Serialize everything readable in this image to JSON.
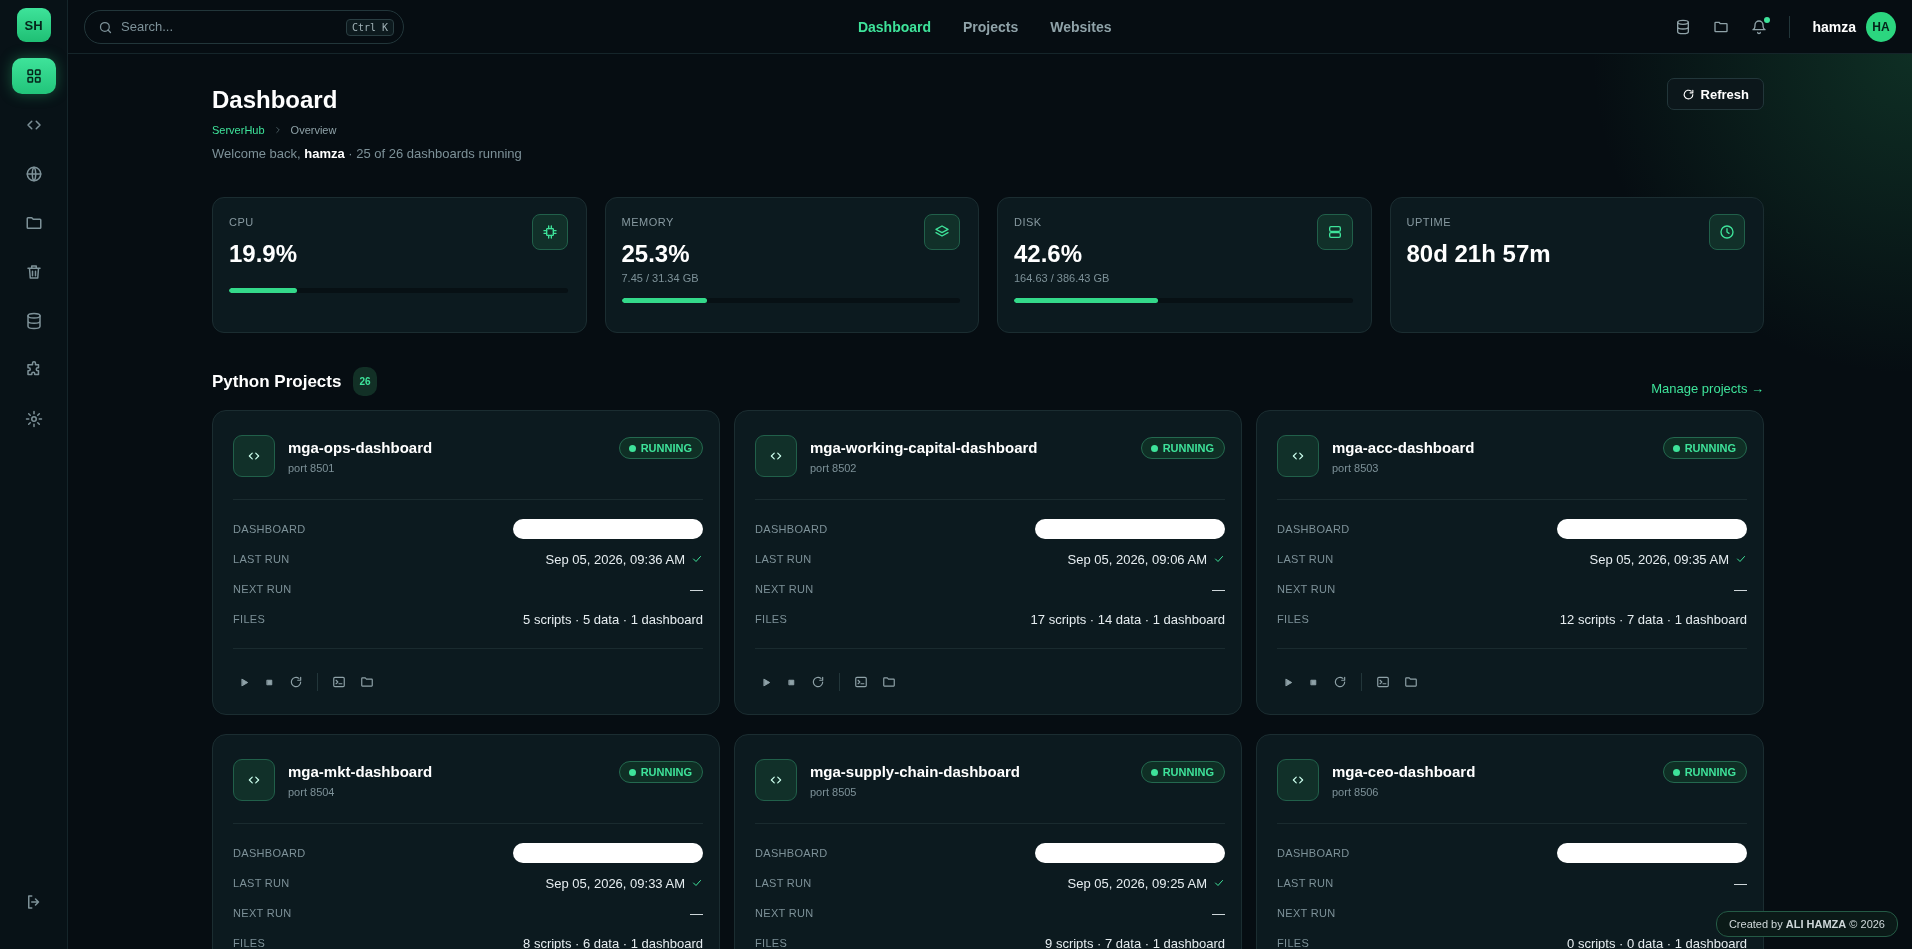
{
  "brand": {
    "logo": "SH"
  },
  "search": {
    "placeholder": "Search...",
    "shortcut": "Ctrl K"
  },
  "nav": {
    "tabs": [
      {
        "label": "Dashboard",
        "selected": true
      },
      {
        "label": "Projects",
        "selected": false
      },
      {
        "label": "Websites",
        "selected": false
      }
    ]
  },
  "topbar": {
    "notification_dot": true,
    "user": "hamza",
    "avatar": "HA"
  },
  "sidebar": {
    "items": [
      {
        "selected": true
      },
      {
        "selected": false
      },
      {
        "selected": false
      },
      {
        "selected": false
      },
      {
        "selected": false
      },
      {
        "selected": false
      },
      {
        "selected": false
      },
      {
        "selected": false
      }
    ]
  },
  "header": {
    "title": "Dashboard",
    "breadcrumb": [
      "ServerHub",
      "Overview"
    ],
    "welcome": "Welcome back, **hamza** · 25 of 26 dashboards running",
    "refresh": "Refresh"
  },
  "stats": [
    {
      "label": "CPU",
      "value": "19.9%",
      "level": 0.2
    },
    {
      "label": "MEMORY",
      "value": "25.3%",
      "detail": "7.45 / 31.34 GB",
      "level": 0.253
    },
    {
      "label": "DISK",
      "value": "42.6%",
      "detail": "164.63 / 386.43 GB",
      "level": 0.426
    },
    {
      "label": "UPTIME",
      "value": "80d 21h 57m"
    }
  ],
  "projects_section": {
    "title": "Python Projects",
    "count": "26",
    "link": "Manage projects →"
  },
  "projects": [
    {
      "labels": [
        "DASHBOARD",
        "LAST RUN",
        "NEXT RUN",
        "FILES"
      ],
      "name": "mga-ops-dashboard",
      "port": "port 8501",
      "status": "RUNNING",
      "last_run": "Sep 05, 2026, 09:36 AM",
      "last_run_ok": true,
      "next_run": "—",
      "files": "5 scripts · 5 data · 1 dashboard"
    },
    {
      "labels": [
        "DASHBOARD",
        "LAST RUN",
        "NEXT RUN",
        "FILES"
      ],
      "name": "mga-working-capital-dashboard",
      "port": "port 8502",
      "status": "RUNNING",
      "last_run": "Sep 05, 2026, 09:06 AM",
      "last_run_ok": true,
      "next_run": "—",
      "files": "17 scripts · 14 data · 1 dashboard"
    },
    {
      "labels": [
        "DASHBOARD",
        "LAST RUN",
        "NEXT RUN",
        "FILES"
      ],
      "name": "mga-acc-dashboard",
      "port": "port 8503",
      "status": "RUNNING",
      "last_run": "Sep 05, 2026, 09:35 AM",
      "last_run_ok": true,
      "next_run": "—",
      "files": "12 scripts · 7 data · 1 dashboard"
    },
    {
      "labels": [
        "DASHBOARD",
        "LAST RUN",
        "NEXT RUN",
        "FILES"
      ],
      "name": "mga-mkt-dashboard",
      "port": "port 8504",
      "status": "RUNNING",
      "last_run": "Sep 05, 2026, 09:33 AM",
      "last_run_ok": true,
      "next_run": "—",
      "files": "8 scripts · 6 data · 1 dashboard"
    },
    {
      "labels": [
        "DASHBOARD",
        "LAST RUN",
        "NEXT RUN",
        "FILES"
      ],
      "name": "mga-supply-chain-dashboard",
      "port": "port 8505",
      "status": "RUNNING",
      "last_run": "Sep 05, 2026, 09:25 AM",
      "last_run_ok": true,
      "next_run": "—",
      "files": "9 scripts · 7 data · 1 dashboard"
    },
    {
      "labels": [
        "DASHBOARD",
        "LAST RUN",
        "NEXT RUN",
        "FILES"
      ],
      "name": "mga-ceo-dashboard",
      "port": "port 8506",
      "status": "RUNNING",
      "last_run": "—",
      "last_run_ok": false,
      "files": "0 scripts · 0 data · 1 dashboard"
    }
  ],
  "footer": {
    "credit": "Created by **ALI HAMZA** © 2026"
  }
}
